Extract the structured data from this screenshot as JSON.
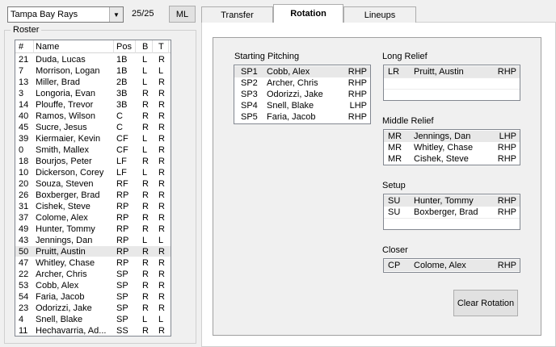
{
  "team": {
    "selected": "Tampa Bay Rays",
    "count": "25/25",
    "ml_label": "ML"
  },
  "tabs": [
    {
      "label": "Transfer"
    },
    {
      "label": "Rotation"
    },
    {
      "label": "Lineups"
    }
  ],
  "roster": {
    "title": "Roster",
    "columns": [
      "#",
      "Name",
      "Pos",
      "B",
      "T"
    ],
    "rows": [
      [
        "21",
        "Duda, Lucas",
        "1B",
        "L",
        "R"
      ],
      [
        "7",
        "Morrison, Logan",
        "1B",
        "L",
        "L"
      ],
      [
        "13",
        "Miller, Brad",
        "2B",
        "L",
        "R"
      ],
      [
        "3",
        "Longoria, Evan",
        "3B",
        "R",
        "R"
      ],
      [
        "14",
        "Plouffe, Trevor",
        "3B",
        "R",
        "R"
      ],
      [
        "40",
        "Ramos, Wilson",
        "C",
        "R",
        "R"
      ],
      [
        "45",
        "Sucre, Jesus",
        "C",
        "R",
        "R"
      ],
      [
        "39",
        "Kiermaier, Kevin",
        "CF",
        "L",
        "R"
      ],
      [
        "0",
        "Smith, Mallex",
        "CF",
        "L",
        "R"
      ],
      [
        "18",
        "Bourjos, Peter",
        "LF",
        "R",
        "R"
      ],
      [
        "10",
        "Dickerson, Corey",
        "LF",
        "L",
        "R"
      ],
      [
        "20",
        "Souza, Steven",
        "RF",
        "R",
        "R"
      ],
      [
        "26",
        "Boxberger, Brad",
        "RP",
        "R",
        "R"
      ],
      [
        "31",
        "Cishek, Steve",
        "RP",
        "R",
        "R"
      ],
      [
        "37",
        "Colome, Alex",
        "RP",
        "R",
        "R"
      ],
      [
        "49",
        "Hunter, Tommy",
        "RP",
        "R",
        "R"
      ],
      [
        "43",
        "Jennings, Dan",
        "RP",
        "L",
        "L"
      ],
      [
        "50",
        "Pruitt, Austin",
        "RP",
        "R",
        "R"
      ],
      [
        "47",
        "Whitley, Chase",
        "RP",
        "R",
        "R"
      ],
      [
        "22",
        "Archer, Chris",
        "SP",
        "R",
        "R"
      ],
      [
        "53",
        "Cobb, Alex",
        "SP",
        "R",
        "R"
      ],
      [
        "54",
        "Faria, Jacob",
        "SP",
        "R",
        "R"
      ],
      [
        "23",
        "Odorizzi, Jake",
        "SP",
        "R",
        "R"
      ],
      [
        "4",
        "Snell, Blake",
        "SP",
        "L",
        "L"
      ],
      [
        "11",
        "Hechavarria, Ad...",
        "SS",
        "R",
        "R"
      ]
    ]
  },
  "rotation": {
    "starting": {
      "title": "Starting Pitching",
      "rows": [
        [
          "SP1",
          "Cobb, Alex",
          "RHP"
        ],
        [
          "SP2",
          "Archer, Chris",
          "RHP"
        ],
        [
          "SP3",
          "Odorizzi, Jake",
          "RHP"
        ],
        [
          "SP4",
          "Snell, Blake",
          "LHP"
        ],
        [
          "SP5",
          "Faria, Jacob",
          "RHP"
        ]
      ]
    },
    "long_relief": {
      "title": "Long Relief",
      "rows": [
        [
          "LR",
          "Pruitt, Austin",
          "RHP"
        ]
      ]
    },
    "middle_relief": {
      "title": "Middle Relief",
      "rows": [
        [
          "MR",
          "Jennings, Dan",
          "LHP"
        ],
        [
          "MR",
          "Whitley, Chase",
          "RHP"
        ],
        [
          "MR",
          "Cishek, Steve",
          "RHP"
        ]
      ]
    },
    "setup": {
      "title": "Setup",
      "rows": [
        [
          "SU",
          "Hunter, Tommy",
          "RHP"
        ],
        [
          "SU",
          "Boxberger, Brad",
          "RHP"
        ]
      ]
    },
    "closer": {
      "title": "Closer",
      "rows": [
        [
          "CP",
          "Colome, Alex",
          "RHP"
        ]
      ]
    },
    "clear_label": "Clear Rotation"
  }
}
